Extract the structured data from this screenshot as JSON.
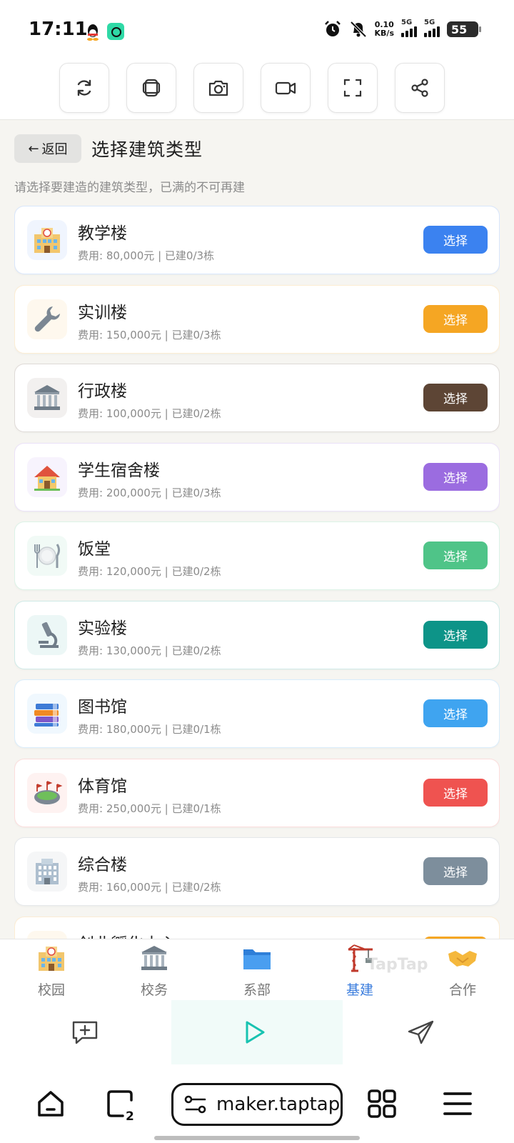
{
  "status_bar": {
    "time": "17:11",
    "net_speed": "0.10",
    "net_speed_unit": "KB/s",
    "signal1_label": "5G",
    "signal2_label": "5G",
    "battery": "55"
  },
  "toolbar": {
    "items": [
      "refresh-icon",
      "layers-icon",
      "screenshot-icon",
      "video-icon",
      "fullscreen-icon",
      "share-icon"
    ]
  },
  "header": {
    "back_label": "返回",
    "title": "选择建筑类型",
    "subtitle": "请选择要建造的建筑类型，已满的不可再建"
  },
  "buildings": [
    {
      "name": "教学楼",
      "meta": "费用: 80,000元 | 已建0/3栋",
      "button": "选择",
      "color": "#3b82f0",
      "icon": "school-building-icon"
    },
    {
      "name": "实训楼",
      "meta": "费用: 150,000元 | 已建0/3栋",
      "button": "选择",
      "color": "#f5a623",
      "icon": "wrench-icon"
    },
    {
      "name": "行政楼",
      "meta": "费用: 100,000元 | 已建0/2栋",
      "button": "选择",
      "color": "#5d4535",
      "icon": "classical-building-icon"
    },
    {
      "name": "学生宿舍楼",
      "meta": "费用: 200,000元 | 已建0/3栋",
      "button": "选择",
      "color": "#9b6ce0",
      "icon": "house-icon"
    },
    {
      "name": "饭堂",
      "meta": "费用: 120,000元 | 已建0/2栋",
      "button": "选择",
      "color": "#4fc488",
      "icon": "fork-knife-plate-icon"
    },
    {
      "name": "实验楼",
      "meta": "费用: 130,000元 | 已建0/2栋",
      "button": "选择",
      "color": "#0d9488",
      "icon": "microscope-icon"
    },
    {
      "name": "图书馆",
      "meta": "费用: 180,000元 | 已建0/1栋",
      "button": "选择",
      "color": "#3fa4f0",
      "icon": "books-icon"
    },
    {
      "name": "体育馆",
      "meta": "费用: 250,000元 | 已建0/1栋",
      "button": "选择",
      "color": "#ef5350",
      "icon": "stadium-icon"
    },
    {
      "name": "综合楼",
      "meta": "费用: 160,000元 | 已建0/2栋",
      "button": "选择",
      "color": "#7d8e9c",
      "icon": "office-building-icon"
    },
    {
      "name": "创业孵化中心",
      "meta": "",
      "button": "选择",
      "color": "#f5a623",
      "icon": "school-building-icon"
    }
  ],
  "bottom_nav": [
    {
      "label": "校园",
      "icon": "school-building-icon",
      "active": false
    },
    {
      "label": "校务",
      "icon": "classical-building-icon",
      "active": false
    },
    {
      "label": "系部",
      "icon": "folder-icon",
      "active": false
    },
    {
      "label": "基建",
      "icon": "crane-icon",
      "active": true
    },
    {
      "label": "合作",
      "icon": "handshake-icon",
      "active": false
    }
  ],
  "watermark": "TapTap",
  "browser": {
    "url": "maker.taptap",
    "tab_count": "2"
  }
}
